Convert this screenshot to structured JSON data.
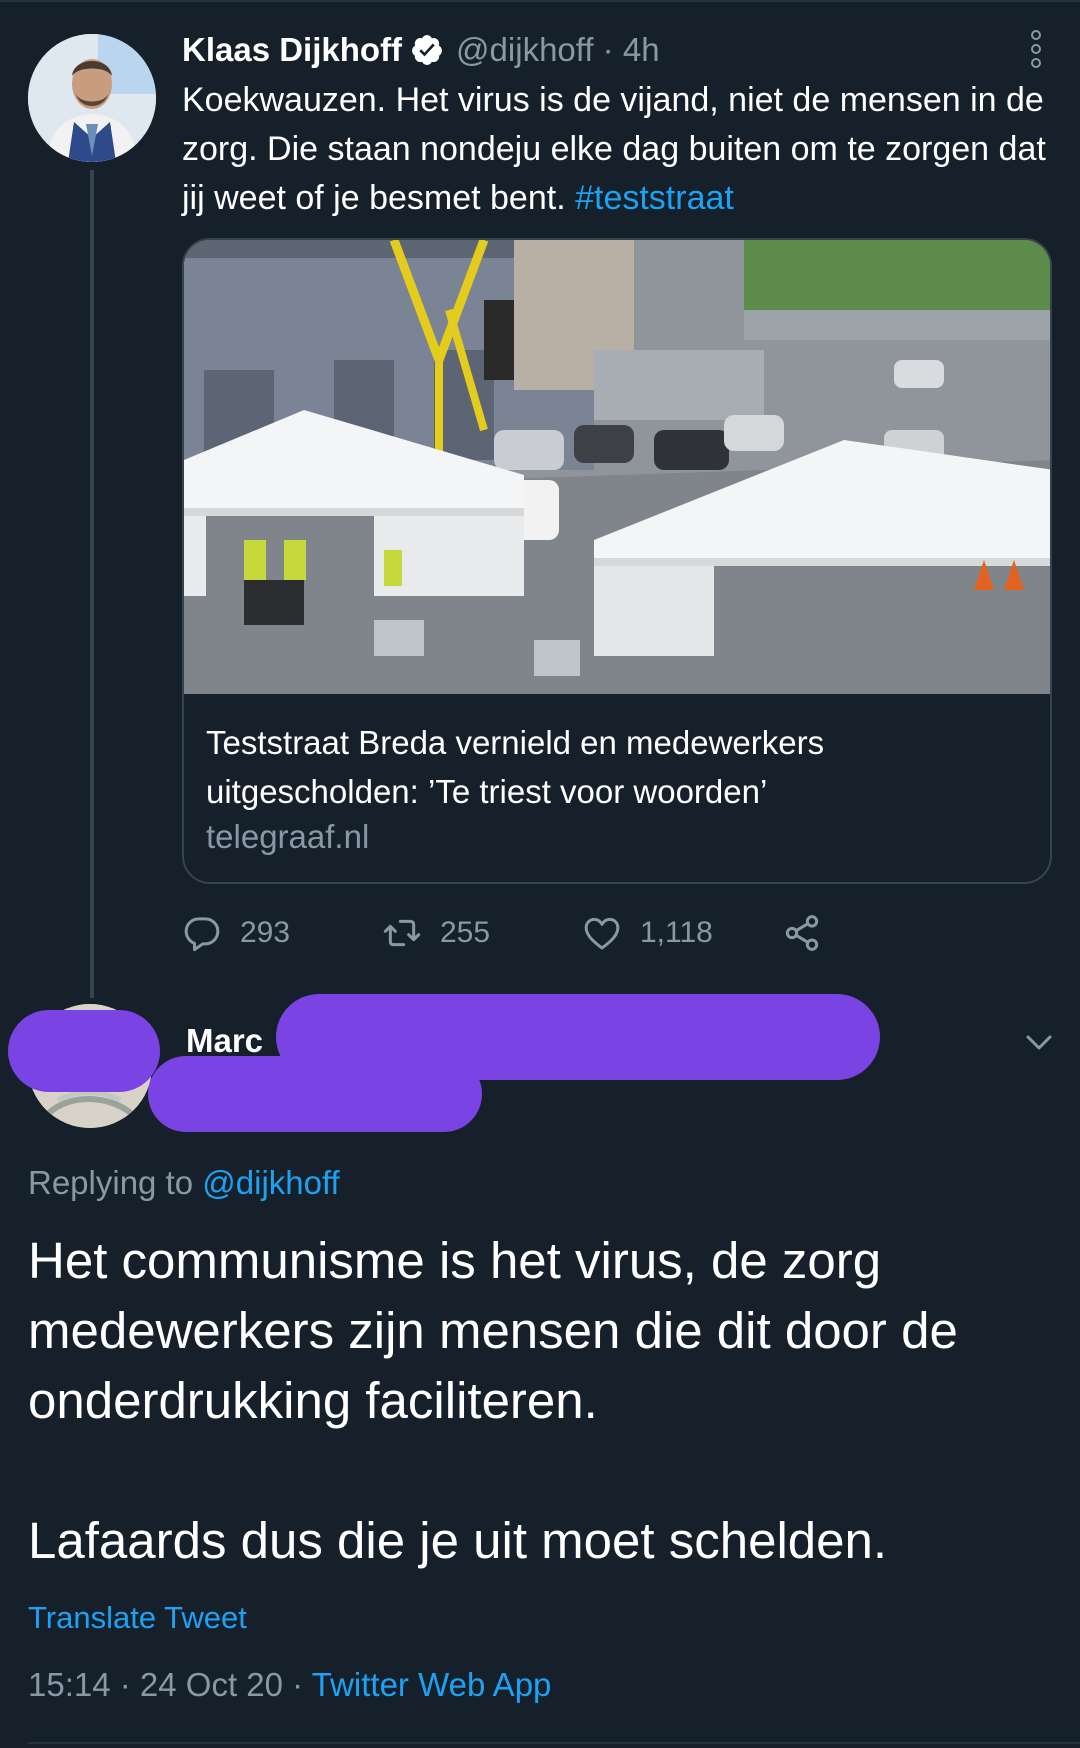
{
  "colors": {
    "background": "#15202b",
    "text_primary": "#ffffff",
    "text_secondary": "#8899a6",
    "link": "#1da1f2",
    "border": "#38444d",
    "redaction": "#7a43e3"
  },
  "parent_tweet": {
    "author_name": "Klaas Dijkhoff",
    "verified_icon": "verified-badge-icon",
    "handle_time": "@dijkhoff · 4h",
    "text": "Koekwauzen. Het virus is de vijand, niet de mensen in de zorg. Die staan nondeju elke dag buiten om te zorgen dat jij weet of je besmet bent. ",
    "hashtag": "#teststraat",
    "card": {
      "title": "Teststraat Breda vernield en medewerkers uitgescholden: ’Te triest voor woorden’",
      "domain": "telegraaf.nl"
    },
    "actions": {
      "replies": "293",
      "retweets": "255",
      "likes": "1,118"
    }
  },
  "reply_tweet": {
    "author_name": "Marc",
    "replying_prefix": "Replying to ",
    "replying_mention": "@dijkhoff",
    "text": "Het communisme is het virus, de zorg medewerkers zijn mensen die dit door de onderdrukking faciliteren.\n\nLafaards dus die je uit moet schelden.",
    "translate_label": "Translate Tweet",
    "timestamp": "15:14 · 24 Oct 20 · ",
    "source_app": "Twitter Web App"
  }
}
